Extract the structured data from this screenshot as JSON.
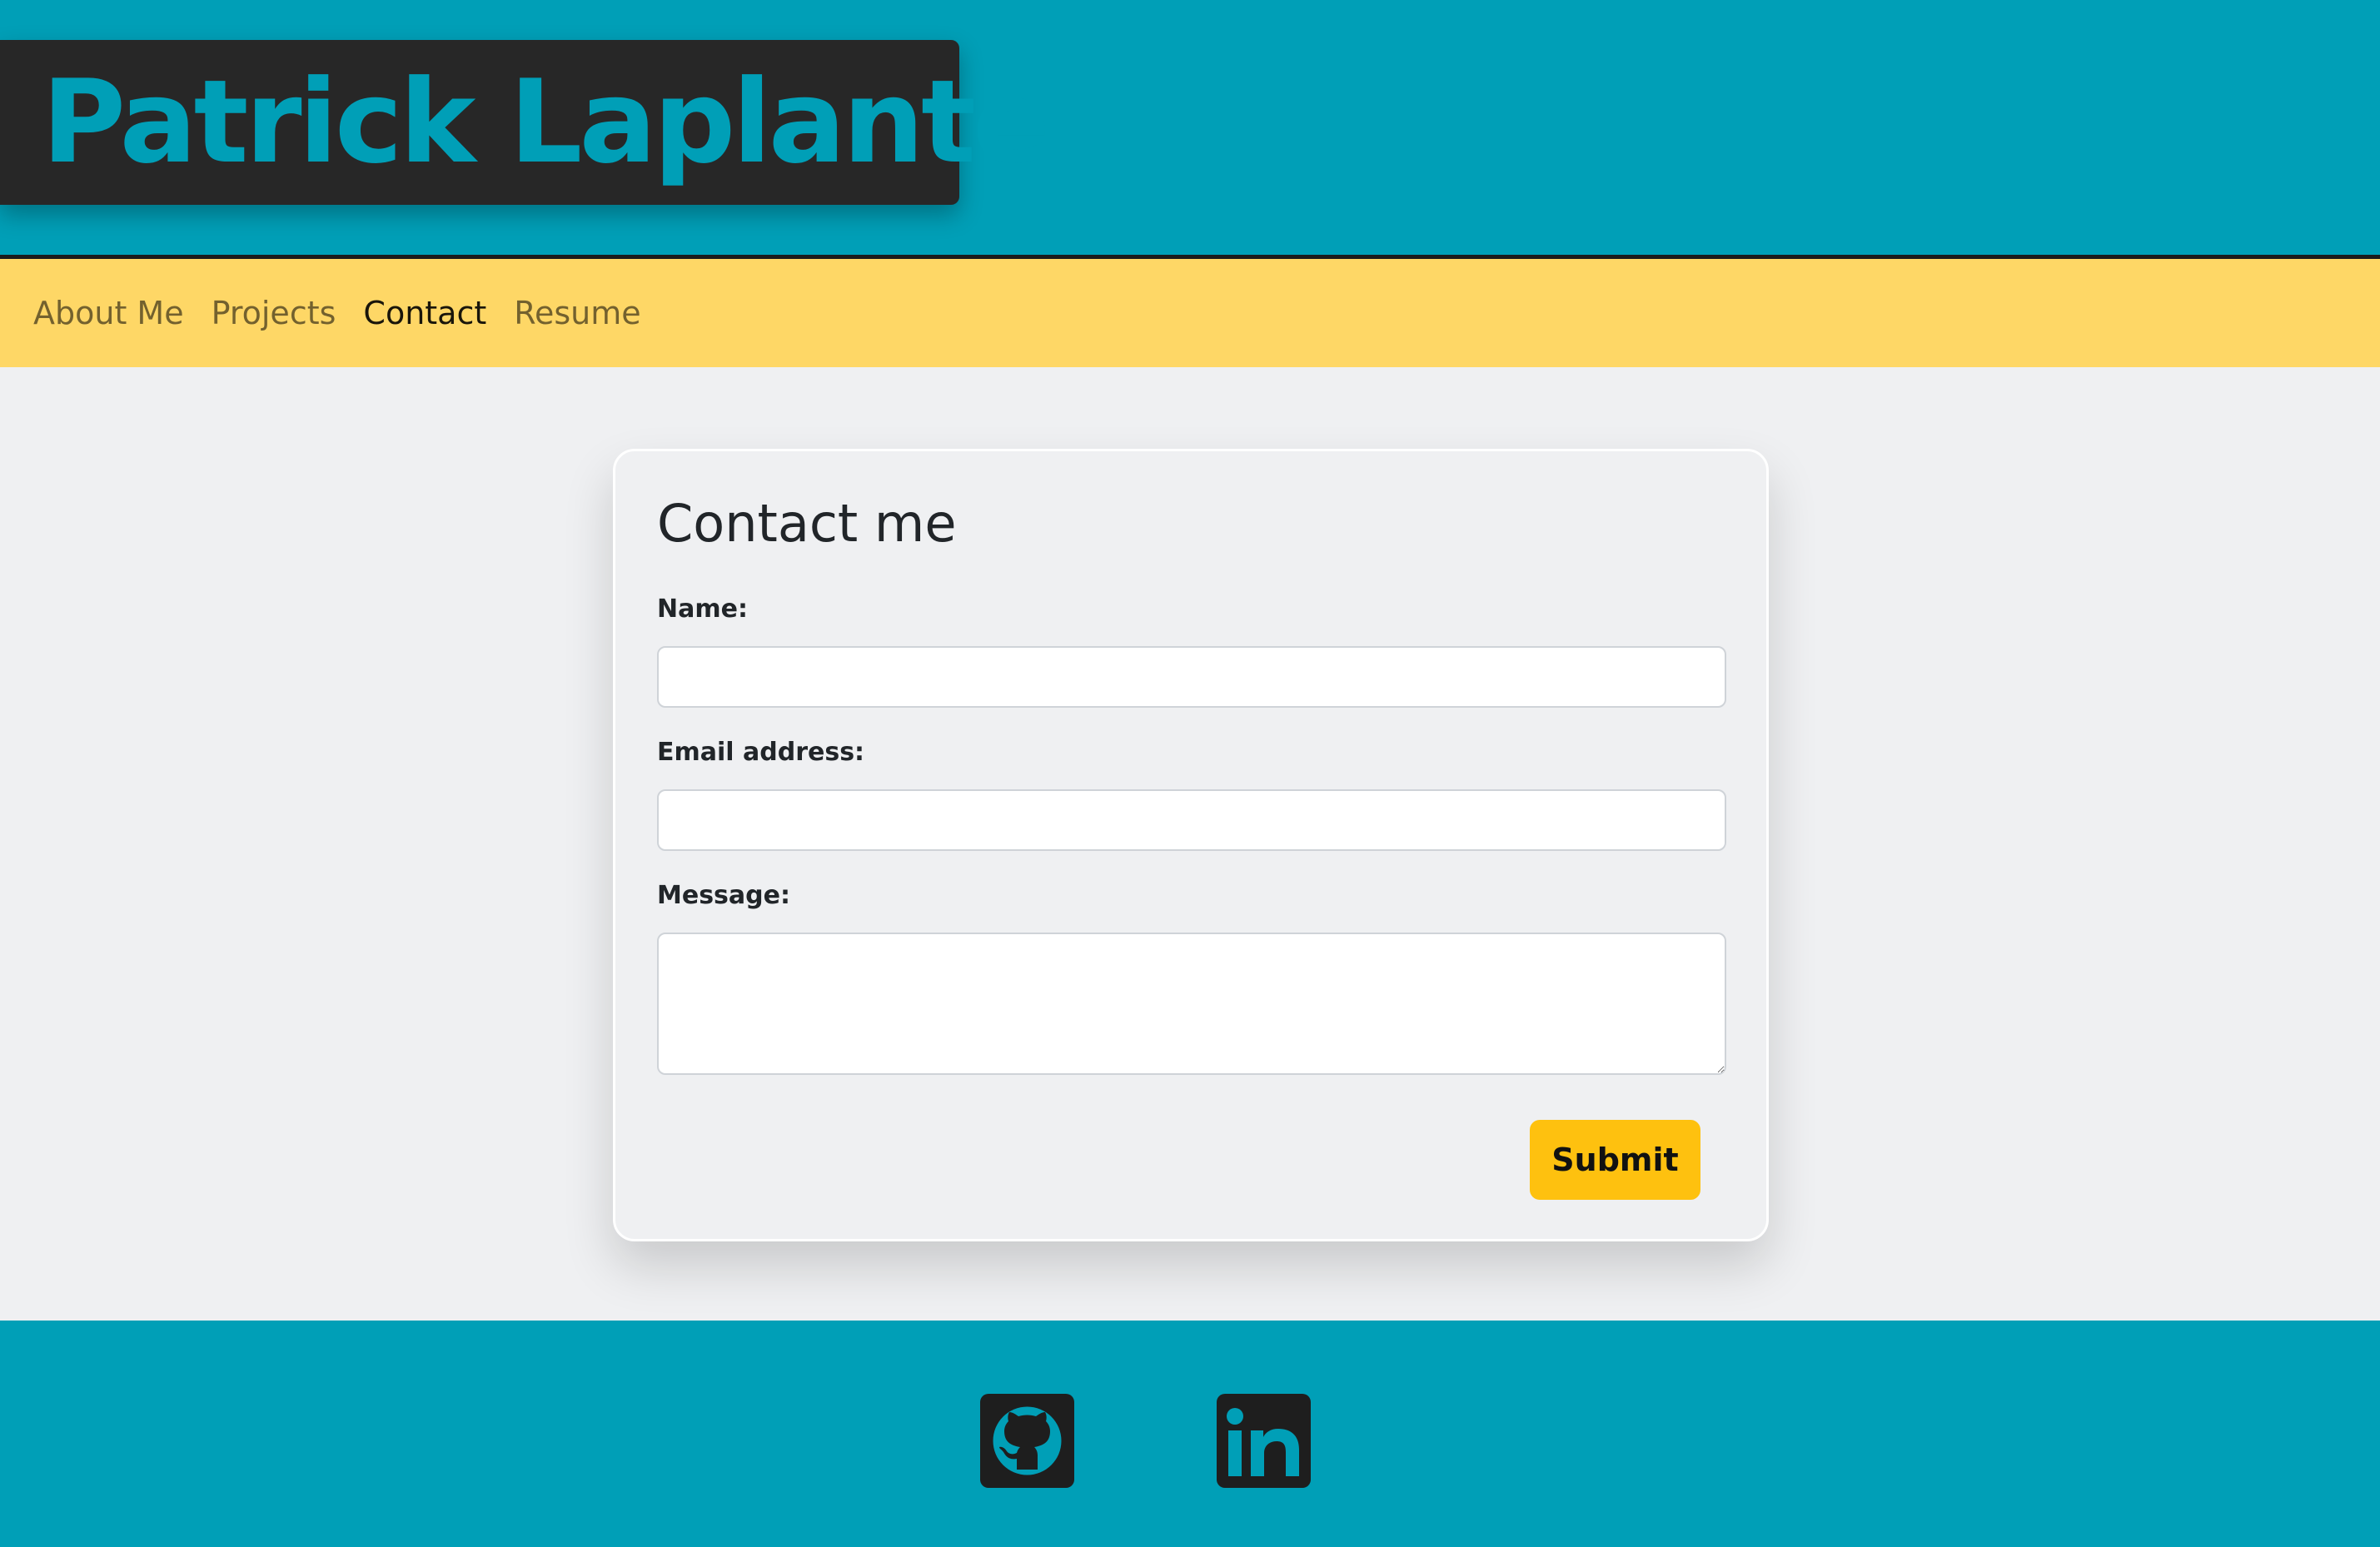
{
  "header": {
    "name": "Patrick Laplante"
  },
  "nav": {
    "items": [
      {
        "label": "About Me",
        "active": false
      },
      {
        "label": "Projects",
        "active": false
      },
      {
        "label": "Contact",
        "active": true
      },
      {
        "label": "Resume",
        "active": false
      }
    ]
  },
  "contact_form": {
    "title": "Contact me",
    "name_label": "Name:",
    "name_value": "",
    "email_label": "Email address:",
    "email_value": "",
    "message_label": "Message:",
    "message_value": "",
    "submit_label": "Submit"
  },
  "footer": {
    "icons": [
      "github-icon",
      "linkedin-icon"
    ]
  },
  "colors": {
    "header_bg": "#009fb7",
    "brand_bg": "#272727",
    "navbar_bg": "#fed766",
    "page_bg": "#eff0f2",
    "submit_bg": "#fec10f",
    "footer_bg": "#009fb7"
  }
}
